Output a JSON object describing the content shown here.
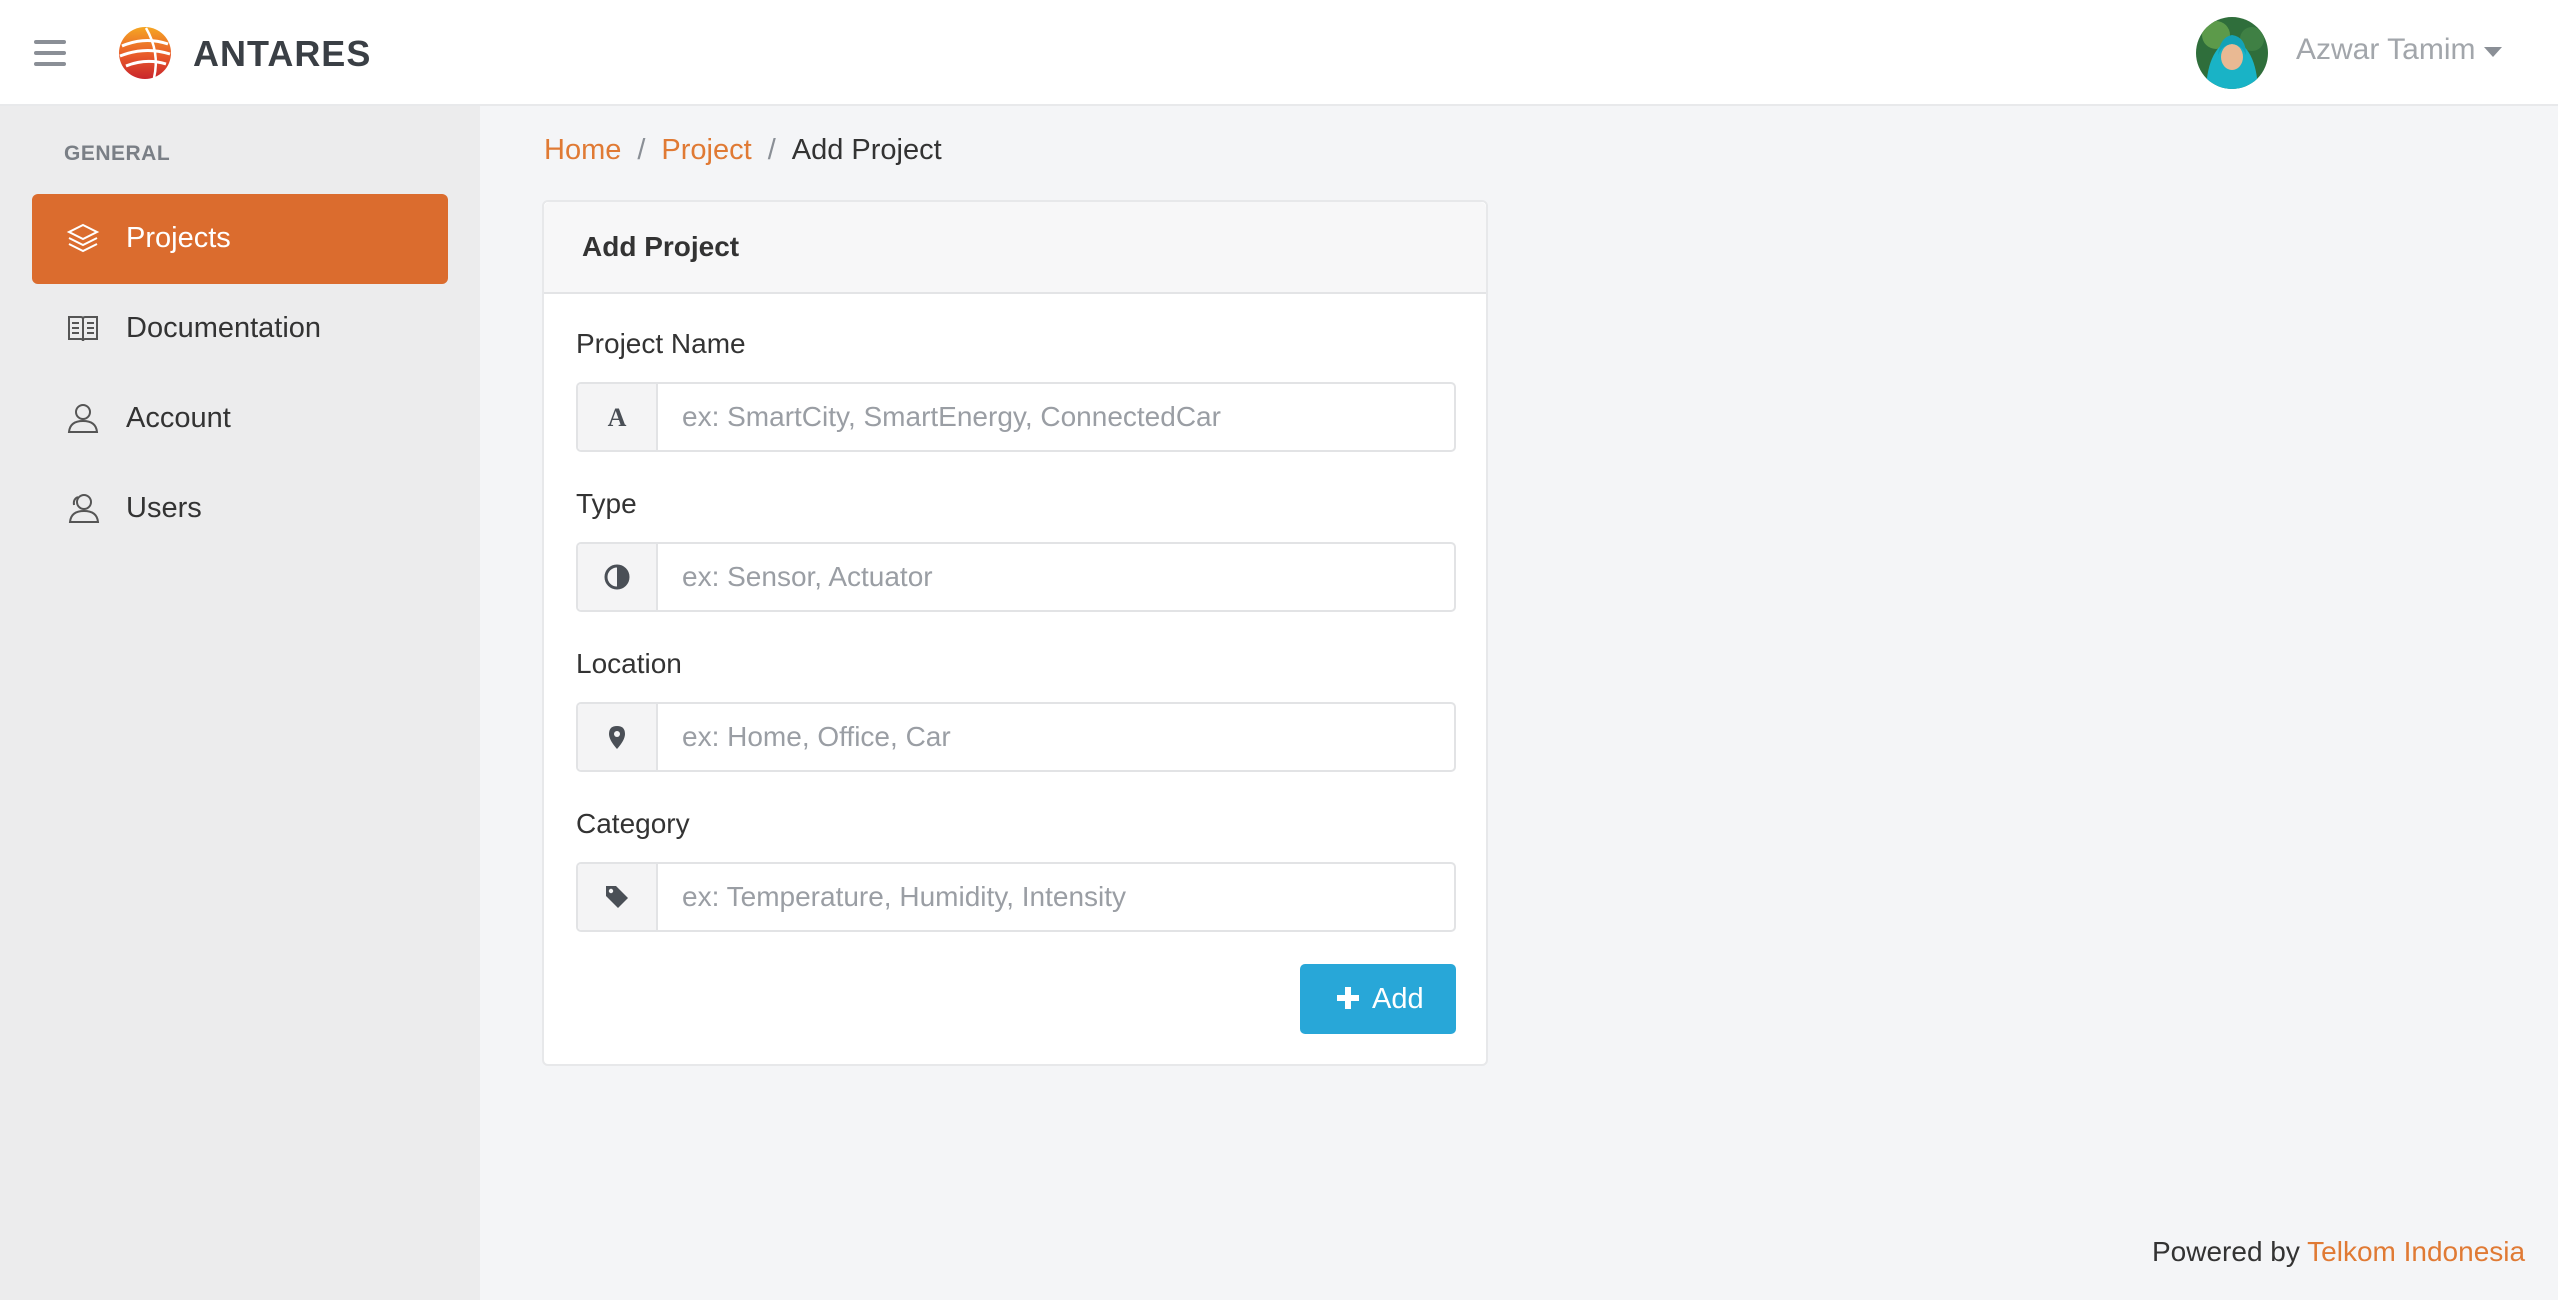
{
  "header": {
    "brand": "ANTARES",
    "user_name": "Azwar Tamim"
  },
  "sidebar": {
    "section_title": "GENERAL",
    "items": [
      {
        "label": "Projects",
        "icon": "layers-icon",
        "active": true
      },
      {
        "label": "Documentation",
        "icon": "book-icon",
        "active": false
      },
      {
        "label": "Account",
        "icon": "user-icon",
        "active": false
      },
      {
        "label": "Users",
        "icon": "users-icon",
        "active": false
      }
    ]
  },
  "breadcrumb": {
    "home": "Home",
    "project": "Project",
    "current": "Add Project",
    "separator": "/"
  },
  "form": {
    "title": "Add Project",
    "fields": [
      {
        "label": "Project Name",
        "placeholder": "ex: SmartCity, SmartEnergy, ConnectedCar",
        "icon": "font-icon"
      },
      {
        "label": "Type",
        "placeholder": "ex: Sensor, Actuator",
        "icon": "adjust-icon"
      },
      {
        "label": "Location",
        "placeholder": "ex: Home, Office, Car",
        "icon": "map-marker-icon"
      },
      {
        "label": "Category",
        "placeholder": "ex: Temperature, Humidity, Intensity",
        "icon": "tag-icon"
      }
    ],
    "submit_label": "Add"
  },
  "footer": {
    "prefix": "Powered by",
    "link": "Telkom Indonesia"
  },
  "colors": {
    "accent": "#db6c2e",
    "link": "#e07a34",
    "button": "#28a7d8"
  }
}
